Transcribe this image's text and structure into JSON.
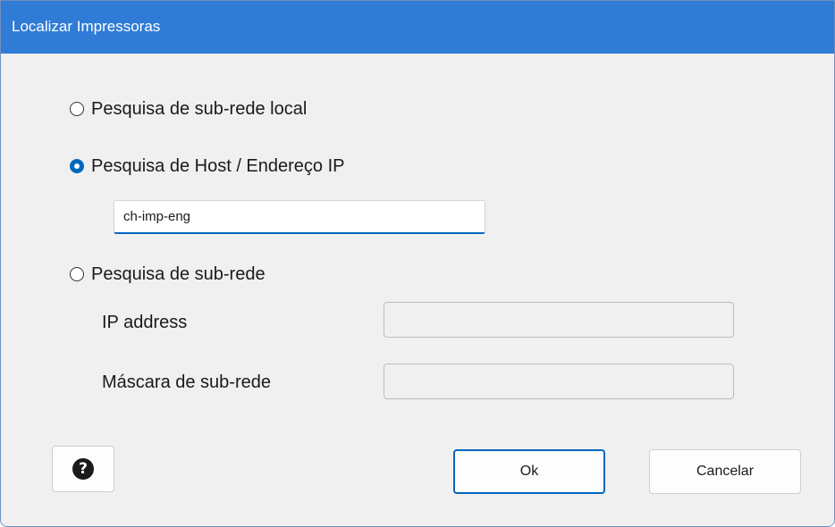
{
  "window": {
    "title": "Localizar Impressoras"
  },
  "options": {
    "local_subnet": {
      "label": "Pesquisa de sub-rede local",
      "checked": false
    },
    "host_ip": {
      "label": "Pesquisa de Host / Endereço IP",
      "checked": true,
      "value": "ch-imp-eng"
    },
    "subnet": {
      "label": "Pesquisa de sub-rede",
      "checked": false
    }
  },
  "subnet_fields": {
    "ip_label": "IP address",
    "ip_value": "",
    "mask_label": "Máscara de sub-rede",
    "mask_value": ""
  },
  "buttons": {
    "help_icon": "?",
    "ok": "Ok",
    "cancel": "Cancelar"
  },
  "icons": {
    "help": "question-circle-icon"
  },
  "colors": {
    "titlebar": "#2f7bd6",
    "accent": "#0067c0",
    "background": "#f0f0f0"
  }
}
